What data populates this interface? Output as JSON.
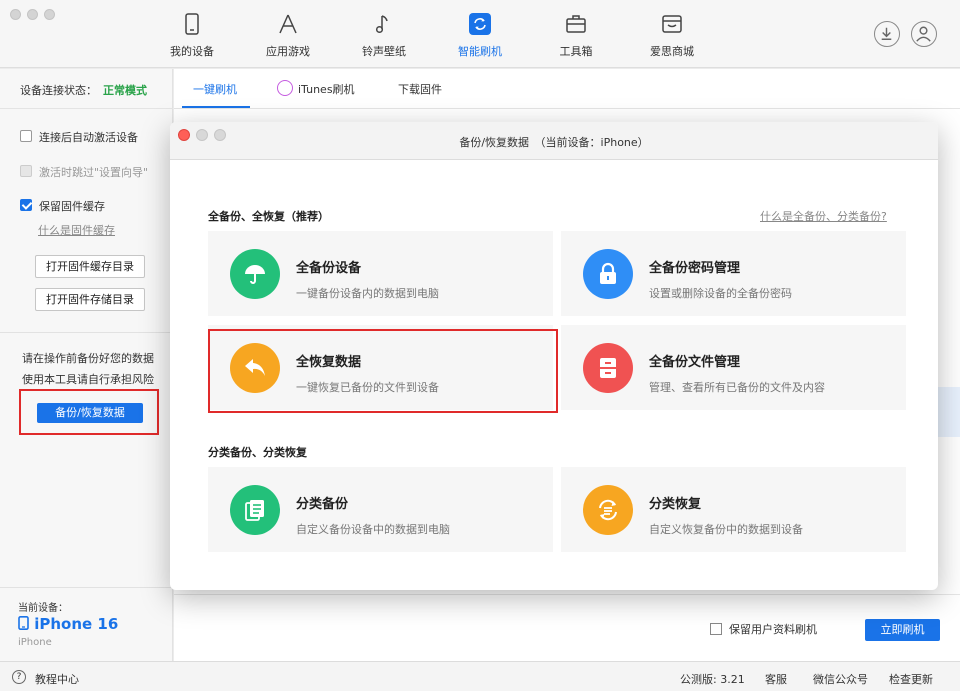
{
  "nav": {
    "items": [
      {
        "label": "我的设备",
        "icon": "phone-icon"
      },
      {
        "label": "应用游戏",
        "icon": "apps-icon"
      },
      {
        "label": "铃声壁纸",
        "icon": "music-note-icon"
      },
      {
        "label": "智能刷机",
        "icon": "refresh-icon",
        "active": true
      },
      {
        "label": "工具箱",
        "icon": "toolbox-icon"
      },
      {
        "label": "爱思商城",
        "icon": "store-icon"
      }
    ],
    "accent": "#1a73e8"
  },
  "left": {
    "status_key": "设备连接状态：",
    "status_value": "正常模式",
    "options": [
      {
        "label": "连接后自动激活设备",
        "checked": false
      },
      {
        "label": "激活时跳过\"设置向导\"",
        "checked": false,
        "disabled": true
      },
      {
        "label": "保留固件缓存",
        "checked": true
      }
    ],
    "cache_link": "什么是固件缓存",
    "open_cache_dir": "打开固件缓存目录",
    "open_store_dir": "打开固件存储目录",
    "warning_line1": "请在操作前备份好您的数据",
    "warning_line2": "使用本工具请自行承担风险",
    "backup_button": "备份/恢复数据",
    "current_device_key": "当前设备：",
    "current_device_name": "iPhone 16",
    "current_device_sub": "iPhone"
  },
  "main": {
    "tabs": [
      "一键刷机",
      "iTunes刷机",
      "下载固件"
    ],
    "keep_user_data": "保留用户资料刷机",
    "flash_now": "立即刷机"
  },
  "statusbar": {
    "help": "教程中心",
    "version": "公测版: 3.21",
    "service": "客服",
    "wechat": "微信公众号",
    "update": "检查更新"
  },
  "modal": {
    "title": "备份/恢复数据　（当前设备：iPhone）",
    "section1": "全备份、全恢复（推荐）",
    "section1_link": "什么是全备份、分类备份?",
    "section2": "分类备份、分类恢复",
    "cards": [
      {
        "title": "全备份设备",
        "desc": "一键备份设备内的数据到电脑",
        "icon": "umbrella-icon",
        "color": "#23c07a"
      },
      {
        "title": "全备份密码管理",
        "desc": "设置或删除设备的全备份密码",
        "icon": "lock-icon",
        "color": "#2f8ef6"
      },
      {
        "title": "全恢复数据",
        "desc": "一键恢复已备份的文件到设备",
        "icon": "restore-arrow-icon",
        "color": "#f7a621"
      },
      {
        "title": "全备份文件管理",
        "desc": "管理、查看所有已备份的文件及内容",
        "icon": "cabinet-icon",
        "color": "#f05252"
      },
      {
        "title": "分类备份",
        "desc": "自定义备份设备中的数据到电脑",
        "icon": "documents-icon",
        "color": "#23c07a"
      },
      {
        "title": "分类恢复",
        "desc": "自定义恢复备份中的数据到设备",
        "icon": "sync-list-icon",
        "color": "#f7a621"
      }
    ]
  }
}
